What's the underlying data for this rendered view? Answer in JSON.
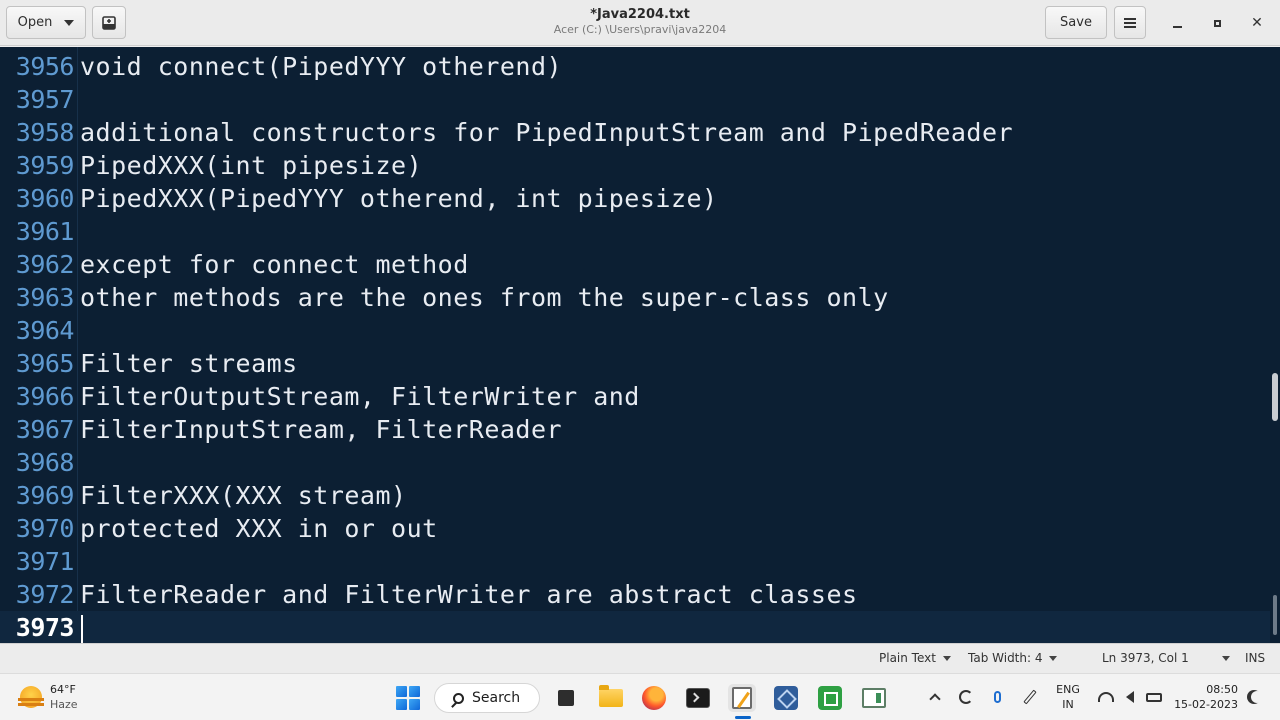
{
  "header": {
    "open_label": "Open",
    "title": "*Java2204.txt",
    "subtitle": "Acer (C:) \\Users\\pravi\\java2204",
    "save_label": "Save"
  },
  "editor": {
    "lines": [
      {
        "num": "3956",
        "text": "void connect(PipedYYY otherend)"
      },
      {
        "num": "3957",
        "text": ""
      },
      {
        "num": "3958",
        "text": "additional constructors for PipedInputStream and PipedReader"
      },
      {
        "num": "3959",
        "text": "PipedXXX(int pipesize)"
      },
      {
        "num": "3960",
        "text": "PipedXXX(PipedYYY otherend, int pipesize)"
      },
      {
        "num": "3961",
        "text": ""
      },
      {
        "num": "3962",
        "text": "except for connect method"
      },
      {
        "num": "3963",
        "text": "other methods are the ones from the super-class only"
      },
      {
        "num": "3964",
        "text": ""
      },
      {
        "num": "3965",
        "text": "Filter streams"
      },
      {
        "num": "3966",
        "text": "FilterOutputStream, FilterWriter and"
      },
      {
        "num": "3967",
        "text": "FilterInputStream, FilterReader"
      },
      {
        "num": "3968",
        "text": ""
      },
      {
        "num": "3969",
        "text": "FilterXXX(XXX stream)"
      },
      {
        "num": "3970",
        "text": "protected XXX in or out"
      },
      {
        "num": "3971",
        "text": ""
      },
      {
        "num": "3972",
        "text": "FilterReader and FilterWriter are abstract classes"
      },
      {
        "num": "3973",
        "text": ""
      }
    ],
    "colors": {
      "background": "#0c1f33",
      "line_numbers": "#5f9ad1",
      "text": "#e8ecf2"
    }
  },
  "statusbar": {
    "language": "Plain Text",
    "tab_width": "Tab Width: 4",
    "position": "Ln 3973, Col 1",
    "mode": "INS"
  },
  "taskbar": {
    "weather_temp": "64°F",
    "weather_cond": "Haze",
    "search_label": "Search",
    "lang_1": "ENG",
    "lang_2": "IN",
    "time": "08:50",
    "date": "15-02-2023"
  }
}
